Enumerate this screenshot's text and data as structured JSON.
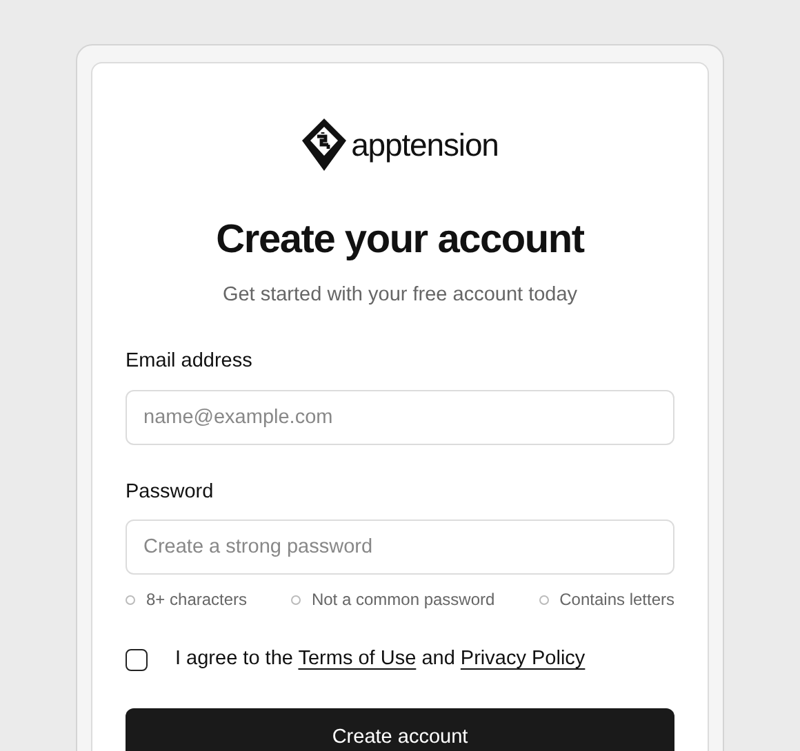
{
  "logo": {
    "text": "apptension"
  },
  "heading": "Create your account",
  "subtitle": "Get started with your free account today",
  "email": {
    "label": "Email address",
    "placeholder": "name@example.com"
  },
  "password": {
    "label": "Password",
    "placeholder": "Create a strong password"
  },
  "requirements": [
    {
      "text": "8+ characters",
      "met": false
    },
    {
      "text": "Not a common password",
      "met": false
    },
    {
      "text": "Contains letters",
      "met": false
    }
  ],
  "agreement": {
    "checked": false,
    "parts": [
      {
        "kind": "text",
        "text": "I agree to the"
      },
      {
        "kind": "link",
        "text": "Terms of Use"
      },
      {
        "kind": "text",
        "text": "and"
      },
      {
        "kind": "link",
        "text": "Privacy Policy"
      }
    ]
  },
  "submit_button": "Create account"
}
